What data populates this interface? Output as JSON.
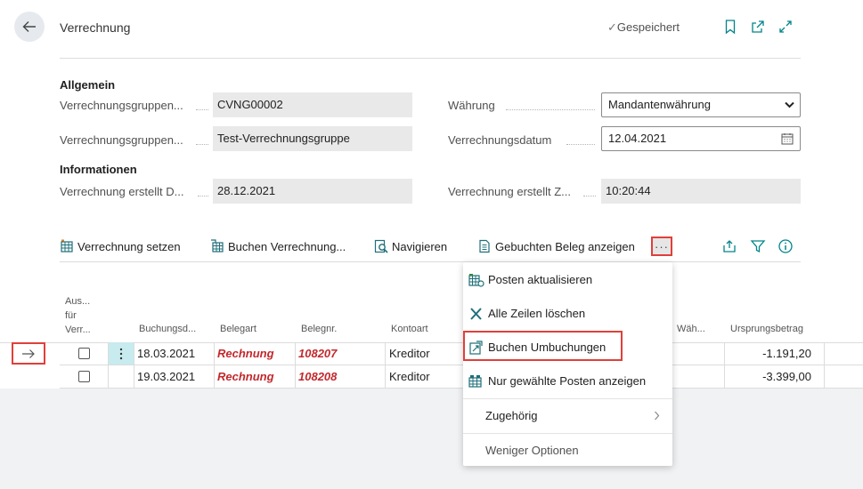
{
  "header": {
    "title": "Verrechnung",
    "saved_label": "Gespeichert"
  },
  "general": {
    "section": "Allgemein",
    "fields": [
      {
        "label": "Verrechnungsgruppen...",
        "value": "CVNG00002"
      },
      {
        "label": "Verrechnungsgruppen...",
        "value": "Test-Verrechnungsgruppe"
      },
      {
        "label": "Währung",
        "value": "Mandantenwährung"
      },
      {
        "label": "Verrechnungsdatum",
        "value": "12.04.2021"
      }
    ]
  },
  "info": {
    "section": "Informationen",
    "fields": [
      {
        "label": "Verrechnung erstellt D...",
        "value": "28.12.2021"
      },
      {
        "label": "Verrechnung erstellt Z...",
        "value": "10:20:44"
      }
    ]
  },
  "actions": {
    "set": "Verrechnung setzen",
    "post": "Buchen Verrechnung...",
    "navigate": "Navigieren",
    "show_doc": "Gebuchten Beleg anzeigen",
    "more": "···"
  },
  "columns": {
    "select": "Aus... für Verr...",
    "date": "Buchungsd...",
    "doctype": "Belegart",
    "docno": "Belegnr.",
    "acctype": "Kontoart",
    "currency": "Wäh...",
    "amount": "Ursprungsbetrag"
  },
  "rows": [
    {
      "date": "18.03.2021",
      "doctype": "Rechnung",
      "docno": "108207",
      "acctype": "Kreditor",
      "amount": "-1.191,20"
    },
    {
      "date": "19.03.2021",
      "doctype": "Rechnung",
      "docno": "108208",
      "acctype": "Kreditor",
      "amount": "-3.399,00"
    }
  ],
  "menu": {
    "items": [
      "Posten aktualisieren",
      "Alle Zeilen löschen",
      "Buchen Umbuchungen",
      "Nur gewählte Posten anzeigen",
      "Zugehörig",
      "Weniger Optionen"
    ]
  },
  "colors": {
    "accent": "#008489",
    "highlight": "#e0403a",
    "doc_red": "#c3282c"
  }
}
